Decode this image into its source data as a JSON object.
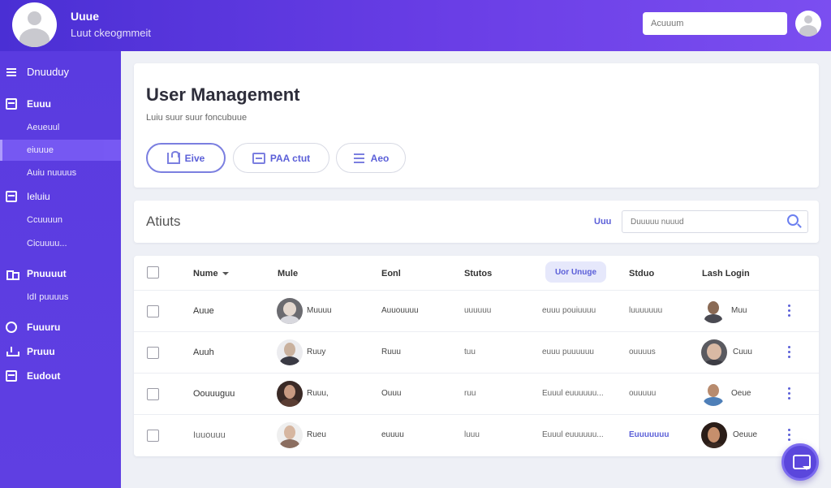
{
  "header": {
    "title": "Uuue",
    "subtitle": "Luut ckeogmmeit",
    "search_placeholder": "Acuuum"
  },
  "sidebar": {
    "top_label": "Dnuuduy",
    "items": [
      {
        "label": "Euuu",
        "icon": "box-icon"
      },
      {
        "label": "Aeueuul"
      },
      {
        "label": "eiuuue"
      },
      {
        "label": "Auiu nuuuus"
      },
      {
        "label": "Ieluiu",
        "icon": "box-icon"
      },
      {
        "label": "Ccuuuun"
      },
      {
        "label": "Cicuuuu..."
      },
      {
        "label": "Pnuuuut",
        "icon": "graph-icon"
      },
      {
        "label": "IdI puuuus"
      },
      {
        "label": "Fuuuru",
        "icon": "circle-icon"
      },
      {
        "label": "Pruuu",
        "icon": "tray-icon"
      },
      {
        "label": "Eudout",
        "icon": "box-icon"
      }
    ]
  },
  "page": {
    "title": "User Management",
    "subtitle": "Luiu suur suur foncubuue",
    "buttons": [
      {
        "label": "Eive",
        "icon": "image-icon"
      },
      {
        "label": "PAA ctut",
        "icon": "card-icon"
      },
      {
        "label": "Aeo",
        "icon": "list-icon"
      }
    ]
  },
  "filter": {
    "title": "Atiuts",
    "label": "Uuu",
    "search_placeholder": "Duuuuu nuuud"
  },
  "table": {
    "columns": [
      "Nume",
      "Mule",
      "Eonl",
      "Stutos",
      "Uor Unuge",
      "Stduo",
      "Lash Login"
    ],
    "rows": [
      {
        "name": "Auue",
        "role": "Muuuu",
        "email": "Auuouuuu",
        "status": "uuuuuu",
        "usage": "euuu pouiuuuu",
        "state": "luuuuuuu",
        "login": "Muu"
      },
      {
        "name": "Auuh",
        "role": "Ruuy",
        "email": "Ruuu",
        "status": "tuu",
        "usage": "euuu puuuuuu",
        "state": "ouuuus",
        "login": "Cuuu"
      },
      {
        "name": "Oouuuguu",
        "role": "Ruuu,",
        "email": "Ouuu",
        "status": "ruu",
        "usage": "Euuul euuuuuu...",
        "state": "ouuuuu",
        "login": "Oeue"
      },
      {
        "name": "Iuuouuu",
        "role": "Rueu",
        "email": "euuuu",
        "status": "luuu",
        "usage": "Euuul euuuuuu...",
        "state": "Euuuuuuu",
        "login": "Oeuue"
      }
    ]
  }
}
